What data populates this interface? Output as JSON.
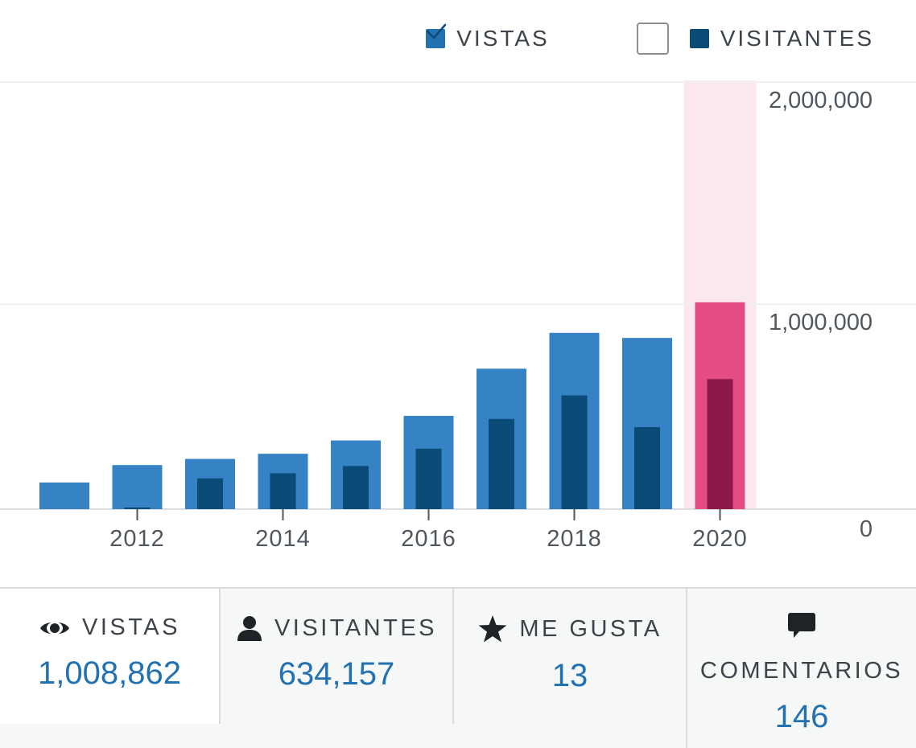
{
  "legend": {
    "views_label": "VISTAS",
    "visitors_label": "VISITANTES",
    "visitors_checked": true
  },
  "colors": {
    "views": "#3582c4",
    "visitors": "#0a4b78",
    "views_highlight": "#e34c84",
    "visitors_highlight": "#8c1749",
    "highlight_band": "#fbe7ef",
    "grid": "#f0f0f1",
    "tick_text": "#50575e",
    "stat_value": "#2271b1"
  },
  "chart_data": {
    "type": "bar",
    "categories": [
      "2011",
      "2012",
      "2013",
      "2014",
      "2015",
      "2016",
      "2017",
      "2018",
      "2019",
      "2020"
    ],
    "x_tick_labels": [
      "2012",
      "2014",
      "2016",
      "2018",
      "2020"
    ],
    "y_tick_labels": [
      "2,000,000",
      "1,000,000",
      "0"
    ],
    "ylim": [
      0,
      2000000
    ],
    "highlighted_category": "2020",
    "series": [
      {
        "name": "VISTAS",
        "values": [
          130000,
          215000,
          245000,
          270000,
          335000,
          455000,
          685000,
          860000,
          835000,
          1008862
        ]
      },
      {
        "name": "VISITANTES",
        "values": [
          0,
          8000,
          150000,
          175000,
          210000,
          295000,
          440000,
          555000,
          400000,
          634157
        ]
      }
    ],
    "grid": true
  },
  "tabs": [
    {
      "icon": "eye-icon",
      "label": "VISTAS",
      "value": "1,008,862"
    },
    {
      "icon": "person-icon",
      "label": "VISITANTES",
      "value": "634,157"
    },
    {
      "icon": "star-icon",
      "label": "ME GUSTA",
      "value": "13"
    },
    {
      "icon": "comment-icon",
      "label": "COMENTARIOS",
      "value": "146"
    }
  ]
}
